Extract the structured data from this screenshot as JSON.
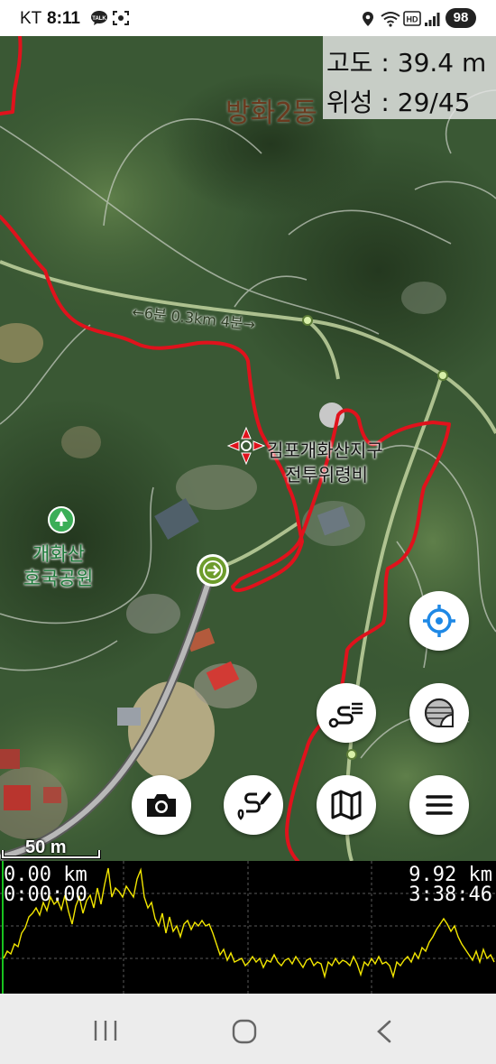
{
  "status_bar": {
    "carrier": "KT",
    "time": "8:11",
    "battery": "98",
    "icons": [
      "kakaotalk-icon",
      "screen-recorder-icon",
      "location-icon",
      "wifi-icon",
      "hd-icon",
      "signal-icon",
      "battery-icon"
    ]
  },
  "map": {
    "labels": {
      "district": "방화2동",
      "trail_hint": "←6분 0.3km 4분→",
      "monument_line1": "김포개화산지구",
      "monument_line2": "전투위령비",
      "park_line1": "개화산",
      "park_line2": "호국공원"
    },
    "track_color": "#e0121c",
    "scale_label": "50 m"
  },
  "info": {
    "altitude": "고도 : 39.4 m",
    "satellites": "위성 : 29/45"
  },
  "buttons": {
    "locate": "crosshair-icon",
    "route_list": "route-list-icon",
    "layer": "map-layer-icon",
    "camera": "camera-icon",
    "draw_route": "draw-route-icon",
    "map": "map-icon",
    "menu": "menu-icon"
  },
  "profile": {
    "start_distance": "0.00 km",
    "start_time": "0:00:00",
    "end_distance": "9.92 km",
    "end_time": "3:38:46",
    "line_color": "#f2e600"
  },
  "nav_bar": {
    "icons": [
      "recent-apps-icon",
      "home-icon",
      "back-icon"
    ]
  }
}
